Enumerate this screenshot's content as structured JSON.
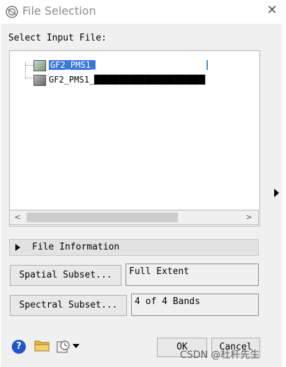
{
  "window": {
    "title": "File Selection",
    "close_icon": "close-x-icon"
  },
  "labels": {
    "select_input_file": "Select Input File:"
  },
  "files": [
    {
      "name": "GF2_PMS1_██████████████████████",
      "selected": true
    },
    {
      "name": "GF2_PMS1_██████████████████████",
      "selected": false
    }
  ],
  "file_info": {
    "label": "File Information"
  },
  "spatial": {
    "button": "Spatial Subset...",
    "value": "Full Extent"
  },
  "spectral": {
    "button": "Spectral Subset...",
    "value": "4 of 4 Bands"
  },
  "buttons": {
    "ok": "OK",
    "cancel": "Cancel"
  },
  "help": {
    "glyph": "?"
  },
  "watermark": "CSDN @杜杆先生",
  "colors": {
    "selection": "#3b78d8",
    "help": "#2156c7",
    "dialog_bg": "#f0f0f0"
  }
}
